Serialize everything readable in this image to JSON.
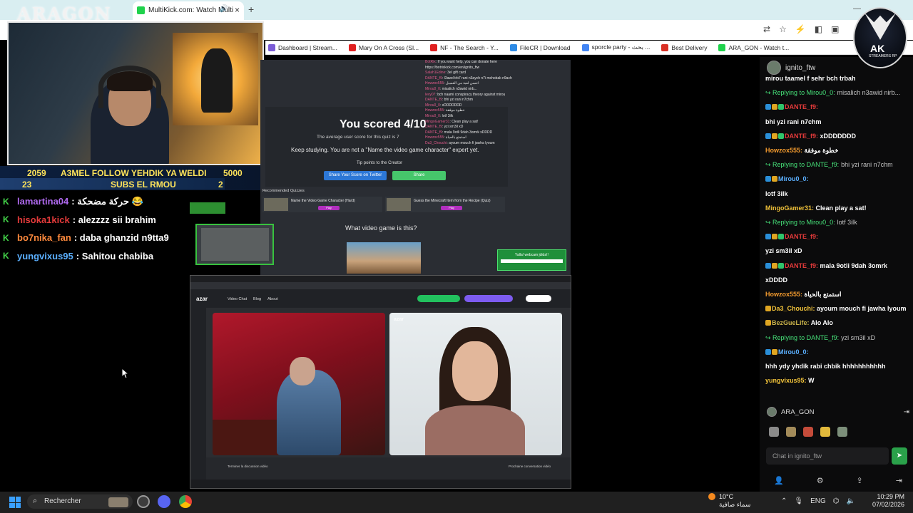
{
  "browser": {
    "tab_title": "MultiKick.com: Watch Multi",
    "new_tab": "+",
    "bookmarks": [
      {
        "label": "Dashboard | Stream...",
        "color": "#7b5cd6"
      },
      {
        "label": "Mary On A Cross (Sl...",
        "color": "#e02020"
      },
      {
        "label": "NF - The Search - Y...",
        "color": "#e02020"
      },
      {
        "label": "FileCR | Download",
        "color": "#2e8be6"
      },
      {
        "label": "sporcle party - بحث ...",
        "color": "#4285f4"
      },
      {
        "label": "Best Delivery",
        "color": "#d93025"
      },
      {
        "label": "ARA_GON - Watch t...",
        "color": "#1fd24c"
      }
    ]
  },
  "overlay": {
    "streamer_logo": "ARAGON",
    "goal_row1": {
      "left": "2059",
      "text": "A3MEL FOLLOW YEHDIK YA WELDI",
      "right": "5000"
    },
    "goal_row2": {
      "left": "23",
      "text": "SUBS EL RMOU",
      "right": "2"
    },
    "goal_progress": {
      "follow": 0.41,
      "subs": 0.85
    },
    "chat": [
      {
        "user": "lamartina04",
        "color": "#b06af0",
        "text": ": حركة مضحكة 😂"
      },
      {
        "user": "hisoka1kick",
        "color": "#e23a3a",
        "text": ": alezzzz sii brahim"
      },
      {
        "user": "bo7nika_fan",
        "color": "#ff8a3d",
        "text": ": daba ghanzid n9tta9"
      },
      {
        "user": "yungvixus95",
        "color": "#5bb0ff",
        "text": ": Sahitou chabiba"
      }
    ]
  },
  "quiz": {
    "score": "You scored 4/10",
    "avg": "The average user score for this quiz is 7",
    "keep": "Keep studying. You are not a \"Name the video game character\" expert yet.",
    "tip": "Tip points to the Creator",
    "share_score": "Share Your Score on Twitter",
    "share": "Share",
    "recommended": "Recommended Quizzes",
    "rec1": "Name the Video Game Character (Hard)",
    "rec2": "Guess the Minecraft Item from the Recipe (Quiz)",
    "play": "Play",
    "question": "What video game is this?",
    "webcam_box": "Yalla! webcam jdida!!"
  },
  "mini_chat": [
    {
      "user": "BotRix",
      "text": ": If you want help, you can donate here"
    },
    {
      "user": "",
      "text": "https://botrixkick.com/en/ignito_ftw"
    },
    {
      "user": "Salah1Edine",
      "text": ": 3el gift card"
    },
    {
      "user": "DANTE_f9",
      "text": ": l3awd trb7 rani n3aych n7i mchobak n9ach"
    },
    {
      "user": "Howzox555",
      "text": ": احسن لعبة من الغسيل"
    },
    {
      "user": "Mirou0_0",
      "text": ": misalich n3awid nirb..."
    },
    {
      "user": "levy07",
      "text": ": bch naami conspiracy theory against mirou"
    },
    {
      "user": "DANTE_f9",
      "text": ": bhi yzi rani n7chm"
    },
    {
      "user": "Mirou0_0",
      "text": ": xDDDDDDD"
    },
    {
      "user": "Howzox555",
      "text": ": خطوة موفقة"
    },
    {
      "user": "Mirou0_0",
      "text": ": lotf 3ilk"
    },
    {
      "user": "MingoGamer31",
      "text": ": Clean play a sat!"
    },
    {
      "user": "DANTE_f9",
      "text": ": yzi sm3il xD"
    },
    {
      "user": "DANTE_f9",
      "text": ": mala 9otli 9dah 3omrk xDDDD"
    },
    {
      "user": "Howzox555",
      "text": ": استمتع بالحياة"
    },
    {
      "user": "Da3_Chouchi",
      "text": ": ayoum mouch fi jawha lyoum"
    }
  ],
  "azar": {
    "logo": "azar",
    "nav_video_chat": "Video Chat",
    "nav_blog": "Blog",
    "nav_about": "About",
    "watermark": "azar",
    "end_chat": "Terminer la discussion vidéo",
    "next_chat": "Prochaine conversation vidéo"
  },
  "chat_panel": {
    "channel": "ignito_ftw",
    "messages": [
      {
        "type": "cont",
        "text": "mirou taamel f sehr bch trbah"
      },
      {
        "type": "reply",
        "reply_to": "Replying to Mirou0_0:",
        "text": "misalich n3awid nirb..."
      },
      {
        "type": "msg",
        "badges": [
          "b-blue",
          "b-gold",
          "b-green"
        ],
        "user": "DANTE_f9",
        "ucolor": "u-red",
        "text": ""
      },
      {
        "type": "cont",
        "text": "bhi yzi rani n7chm"
      },
      {
        "type": "msg",
        "badges": [
          "b-blue",
          "b-gold",
          "b-green"
        ],
        "user": "DANTE_f9",
        "ucolor": "u-red",
        "text": "xDDDDDDD"
      },
      {
        "type": "msg",
        "badges": [],
        "user": "Howzox555",
        "ucolor": "u-orange",
        "text": "خطوة موفقة"
      },
      {
        "type": "reply",
        "reply_to": "Replying to DANTE_f9:",
        "text": "bhi yzi rani n7chm"
      },
      {
        "type": "msg",
        "badges": [
          "b-blue",
          "b-gold"
        ],
        "user": "Mirou0_0",
        "ucolor": "u-blue",
        "text": ""
      },
      {
        "type": "cont",
        "text": "lotf 3ilk"
      },
      {
        "type": "msg",
        "badges": [],
        "user": "MingoGamer31",
        "ucolor": "u-gold",
        "text": "Clean play a sat!"
      },
      {
        "type": "reply",
        "reply_to": "Replying to Mirou0_0:",
        "text": "lotf 3ilk"
      },
      {
        "type": "msg",
        "badges": [
          "b-blue",
          "b-gold",
          "b-green"
        ],
        "user": "DANTE_f9",
        "ucolor": "u-red",
        "text": ""
      },
      {
        "type": "cont",
        "text": "yzi sm3il xD"
      },
      {
        "type": "msg",
        "badges": [
          "b-blue",
          "b-gold",
          "b-green"
        ],
        "user": "DANTE_f9",
        "ucolor": "u-red",
        "text": "mala 9otli 9dah 3omrk"
      },
      {
        "type": "cont",
        "text": "xDDDD"
      },
      {
        "type": "msg",
        "badges": [],
        "user": "Howzox555",
        "ucolor": "u-orange",
        "text": "استمتع بالحياة"
      },
      {
        "type": "msg",
        "badges": [
          "b-gold"
        ],
        "user": "Da3_Chouchi",
        "ucolor": "u-gold",
        "text": "ayoum mouch fi jawha lyoum"
      },
      {
        "type": "msg",
        "badges": [
          "b-gold"
        ],
        "user": "BezGueLife",
        "ucolor": "u-dg",
        "text": "Alo Alo"
      },
      {
        "type": "reply",
        "reply_to": "Replying to DANTE_f9:",
        "text": "yzi sm3il xD"
      },
      {
        "type": "msg",
        "badges": [
          "b-blue",
          "b-gold"
        ],
        "user": "Mirou0_0",
        "ucolor": "u-blue",
        "text": ""
      },
      {
        "type": "cont",
        "text": "hhh ydy yhdik rabi chbik hhhhhhhhhhh"
      },
      {
        "type": "msg",
        "badges": [],
        "user": "yungvixus95",
        "ucolor": "u-gold",
        "text": "W"
      }
    ],
    "logged_user": "ARA_GON",
    "input_placeholder": "Chat in ignito_ftw"
  },
  "ak_logo": {
    "title": "AK",
    "subtitle": "STREAMERS RP"
  },
  "taskbar": {
    "search": "Rechercher",
    "temp": "10°C",
    "weather": "سماء صافية",
    "lang": "ENG",
    "time": "10:29 PM",
    "date": "07/02/2026"
  }
}
